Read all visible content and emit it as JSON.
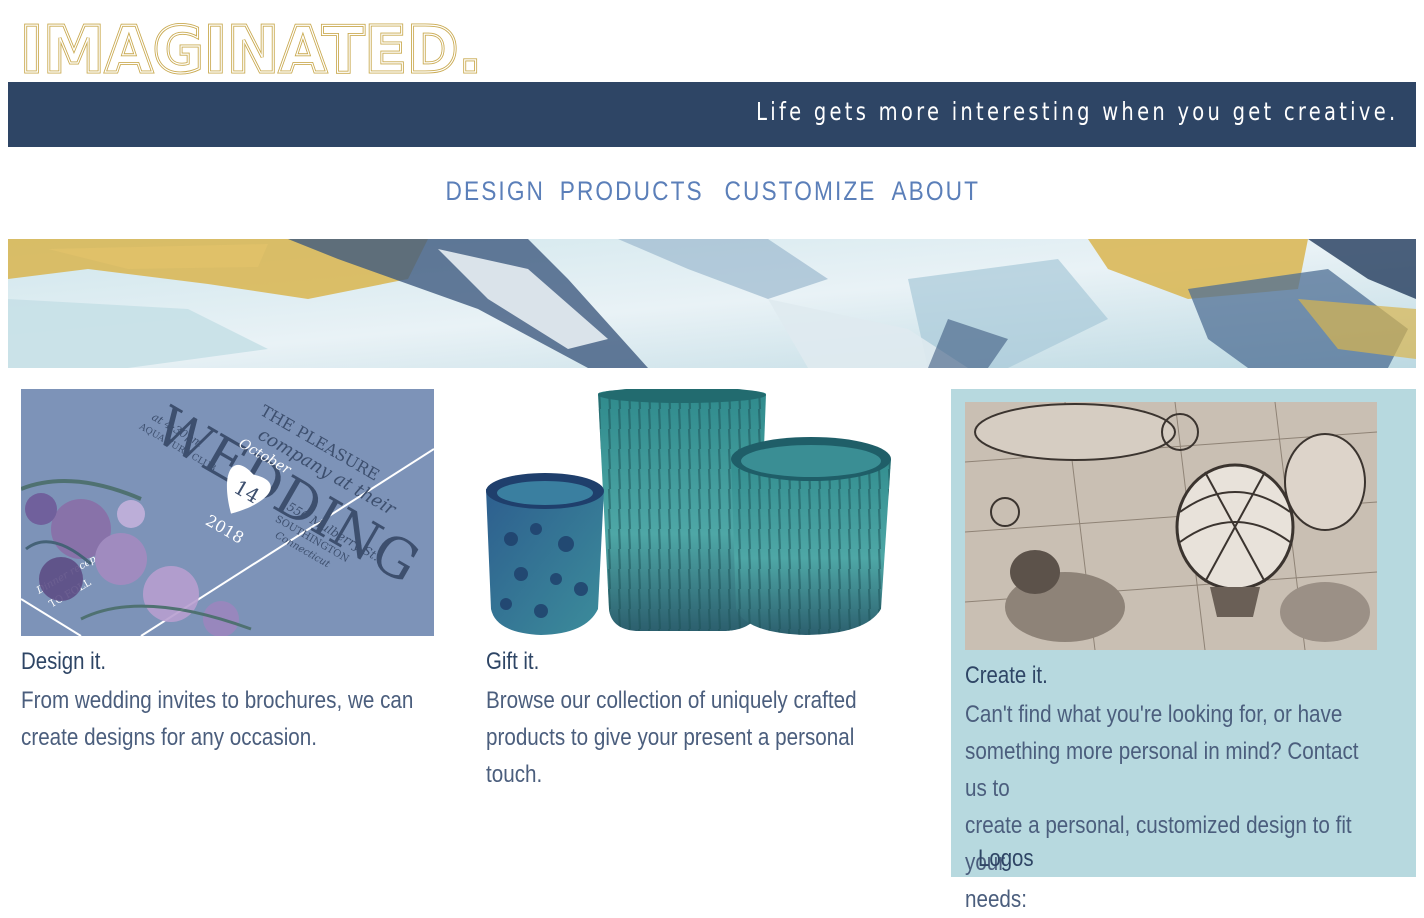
{
  "brand": {
    "logo_text": "IMAGINATED."
  },
  "tagline": "Life gets more interesting when you get creative.",
  "nav": [
    {
      "label": "DESIGN"
    },
    {
      "label": "PRODUCTS"
    },
    {
      "label": "CUSTOMIZE"
    },
    {
      "label": "ABOUT"
    }
  ],
  "cards": [
    {
      "title": "Design it.",
      "text_lines": [
        "From wedding invites to brochures, we can",
        "create designs for any occasion."
      ]
    },
    {
      "title": "Gift it.",
      "text_lines": [
        "Browse our collection of uniquely crafted",
        "products to give your present a personal touch."
      ]
    },
    {
      "title": "Create it.",
      "text_lines": [
        "Can't find what you're looking for, or have",
        "something more personal in mind? Contact us to",
        "create a personal, customized design to fit your",
        "needs:"
      ],
      "list": [
        "Logos"
      ]
    }
  ],
  "invite": {
    "words": [
      "WEDDING",
      "THE PLEASURE",
      "company at their",
      "October",
      "14",
      "2018",
      "at 4:30pm",
      "AQUA TURF CLUB",
      "556 Mulberry St.",
      "SOUTHINGTON",
      "Connecticut",
      "Dinner recep",
      "TO FOLL"
    ]
  },
  "colors": {
    "navy": "#2e4565",
    "gold": "#c9a94f",
    "nav_blue": "#5b7fb9",
    "light_teal": "#b7d9df",
    "invite_bg": "#7d93b8"
  }
}
